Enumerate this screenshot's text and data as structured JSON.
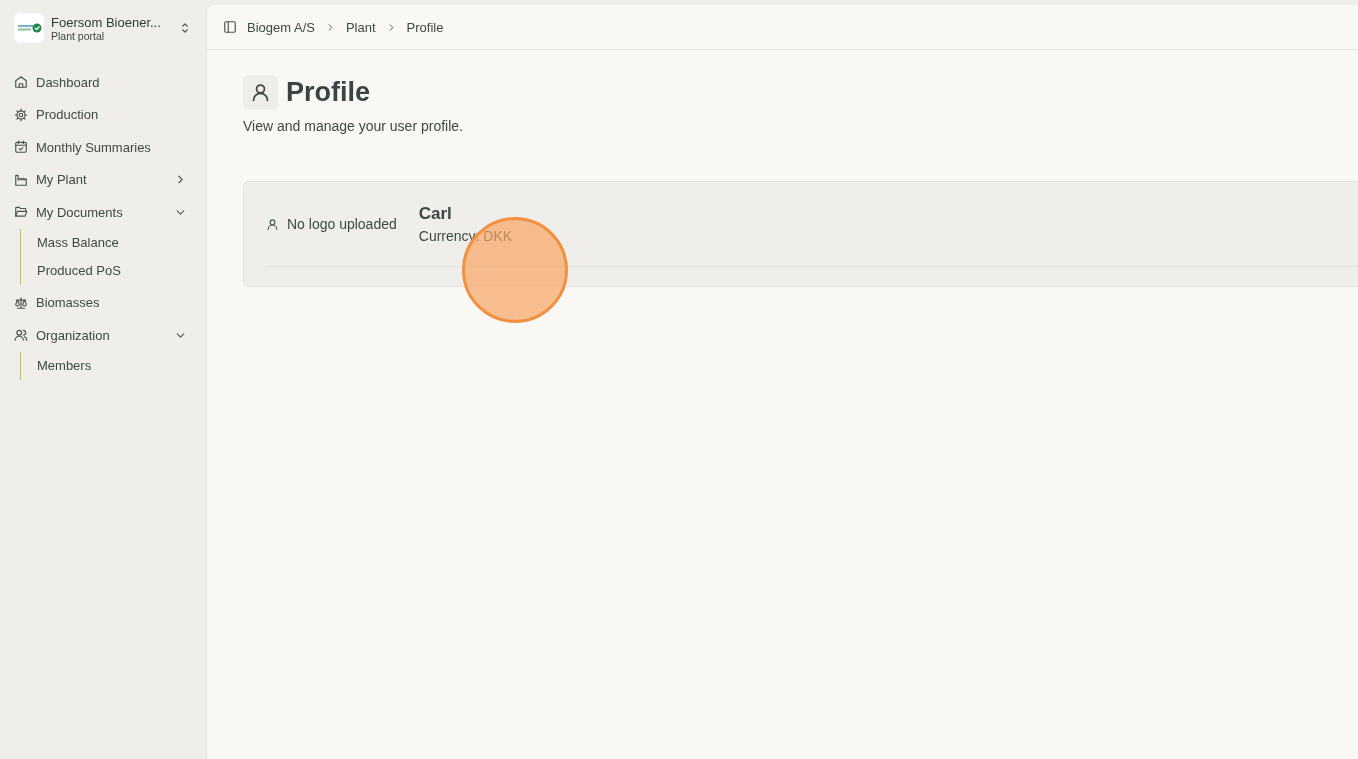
{
  "sidebar": {
    "org": {
      "name": "Foersom Bioener...",
      "subtitle": "Plant portal"
    },
    "items": [
      {
        "label": "Dashboard"
      },
      {
        "label": "Production"
      },
      {
        "label": "Monthly Summaries"
      },
      {
        "label": "My Plant",
        "expanded": false
      },
      {
        "label": "My Documents",
        "expanded": true,
        "children": [
          {
            "label": "Mass Balance"
          },
          {
            "label": "Produced PoS"
          }
        ]
      },
      {
        "label": "Biomasses"
      },
      {
        "label": "Organization",
        "expanded": true,
        "children": [
          {
            "label": "Members"
          }
        ]
      }
    ]
  },
  "breadcrumb": [
    "Biogem A/S",
    "Plant",
    "Profile"
  ],
  "page": {
    "title": "Profile",
    "subtitle": "View and manage your user profile."
  },
  "profile_card": {
    "logo_note": "No logo uploaded",
    "name": "Carl",
    "currency": "Currency: DKK"
  }
}
